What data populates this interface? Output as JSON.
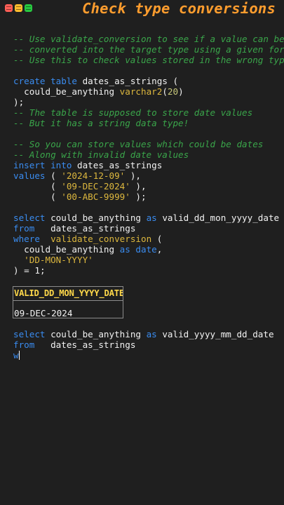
{
  "window": {
    "title": "Check type conversions",
    "controls": [
      "close",
      "minimize",
      "maximize"
    ]
  },
  "colors": {
    "background": "#1f1f1f",
    "title": "#ff9d2e",
    "comment": "#3aa54a",
    "keyword": "#3a8cf0",
    "string": "#dcb73e",
    "header": "#ffd84a"
  },
  "code": {
    "c1": "-- Use validate_conversion to see if a value can be",
    "c2": "-- converted into the target type using a given format",
    "c3": "-- Use this to check values stored in the wrong type",
    "create_kw": "create table",
    "create_name": " dates_as_strings (",
    "col_name": "  could_be_anything ",
    "col_type": "varchar2",
    "col_open": "(",
    "col_len": "20",
    "col_close": ")",
    "create_end": ");",
    "c4": "-- The table is supposed to store date values",
    "c5": "-- But it has a string data type!",
    "c6": "-- So you can store values which could be dates",
    "c7": "-- Along with invalid date values",
    "insert_kw": "insert into",
    "insert_name": " dates_as_strings",
    "values_kw": "values",
    "v1_pre": " ( ",
    "v1": "'2024-12-09'",
    "v1_post": " ),",
    "v2_pre": "       ( ",
    "v2": "'09-DEC-2024'",
    "v2_post": " ),",
    "v3_pre": "       ( ",
    "v3": "'00-ABC-9999'",
    "v3_post": " );",
    "sel_kw": "select",
    "sel_col": " could_be_anything ",
    "as_kw": "as",
    "sel_alias": " valid_dd_mon_yyyy_date",
    "from_kw": "from",
    "from_tbl": "   dates_as_strings",
    "where_kw": "where",
    "where_fn": "  validate_conversion",
    "where_open": " (",
    "arg_col": "  could_be_anything ",
    "arg_as": "as",
    "arg_type": " date",
    "arg_comma": ",",
    "arg_fmt_pre": "  ",
    "arg_fmt": "'DD-MON-YYYY'",
    "where_end": ") = ",
    "where_num": "1",
    "where_semi": ";"
  },
  "result": {
    "header": "VALID_DD_MON_YYYY_DATE",
    "rows": [
      "09-DEC-2024"
    ]
  },
  "query2": {
    "sel_kw": "select",
    "sel_col": " could_be_anything ",
    "as_kw": "as",
    "sel_alias": " valid_yyyy_mm_dd_date",
    "from_kw": "from",
    "from_tbl": "   dates_as_strings",
    "typing": "w"
  }
}
